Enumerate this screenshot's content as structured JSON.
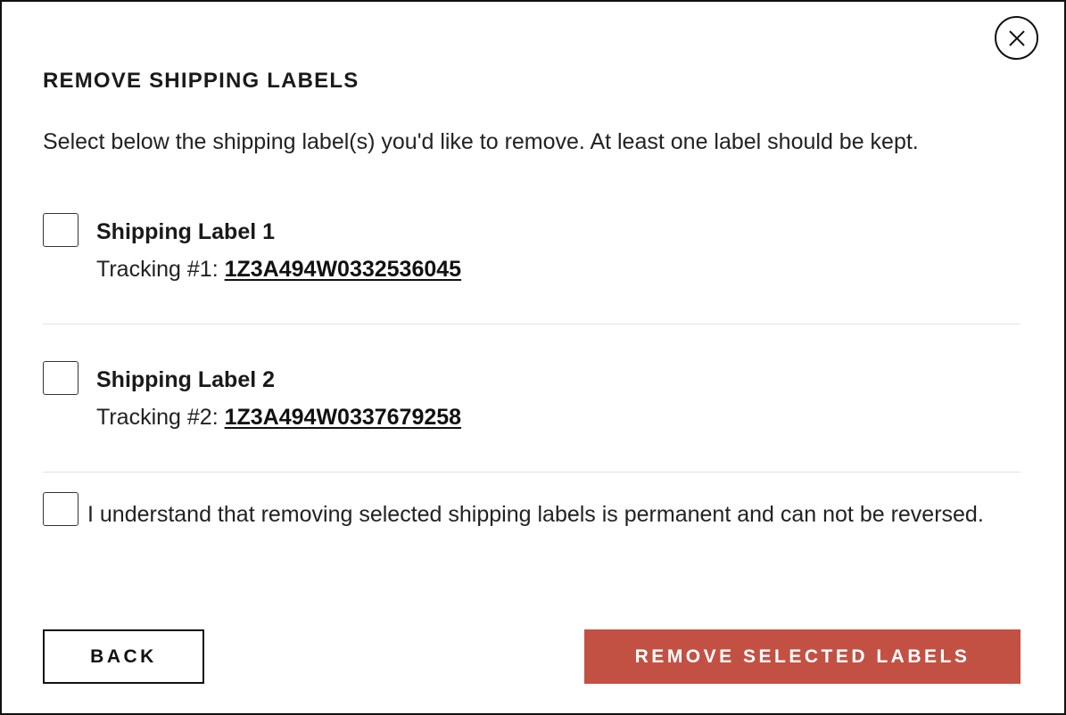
{
  "dialog": {
    "title": "REMOVE SHIPPING LABELS",
    "instructions": "Select below the shipping label(s) you'd like to remove. At least one label should be kept.",
    "close_icon": "close-icon"
  },
  "labels": [
    {
      "title": "Shipping Label 1",
      "tracking_prefix": "Tracking #1: ",
      "tracking_number": "1Z3A494W0332536045",
      "checked": false
    },
    {
      "title": "Shipping Label 2",
      "tracking_prefix": "Tracking #2: ",
      "tracking_number": "1Z3A494W0337679258",
      "checked": false
    }
  ],
  "confirmation": {
    "text": "I understand that removing selected shipping labels is permanent and can not be reversed.",
    "checked": false
  },
  "actions": {
    "back_label": "BACK",
    "remove_label": "REMOVE SELECTED LABELS"
  },
  "colors": {
    "accent": "#c25144",
    "border": "#111111",
    "divider": "#e2e2e2"
  }
}
